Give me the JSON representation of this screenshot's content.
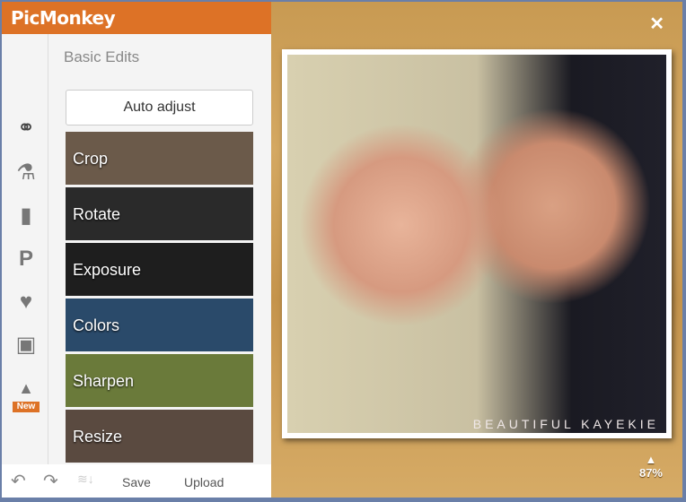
{
  "app": {
    "logo": "PicMonkey"
  },
  "sidebar": {
    "title": "Basic Edits",
    "auto_adjust": "Auto adjust",
    "new_badge": "New",
    "tools": [
      {
        "label": "Crop",
        "bg": "#6b5a4a"
      },
      {
        "label": "Rotate",
        "bg": "#2a2a2a"
      },
      {
        "label": "Exposure",
        "bg": "#1e1e1e"
      },
      {
        "label": "Colors",
        "bg": "#2a4a6a"
      },
      {
        "label": "Sharpen",
        "bg": "#6a7a3a"
      },
      {
        "label": "Resize",
        "bg": "#5a4a40"
      }
    ]
  },
  "bottom": {
    "save": "Save",
    "upload": "Upload"
  },
  "canvas": {
    "watermark": "BEAUTIFUL KAYEKIE",
    "zoom": "87%",
    "close": "✕"
  },
  "colors": {
    "brand": "#dd7226"
  }
}
